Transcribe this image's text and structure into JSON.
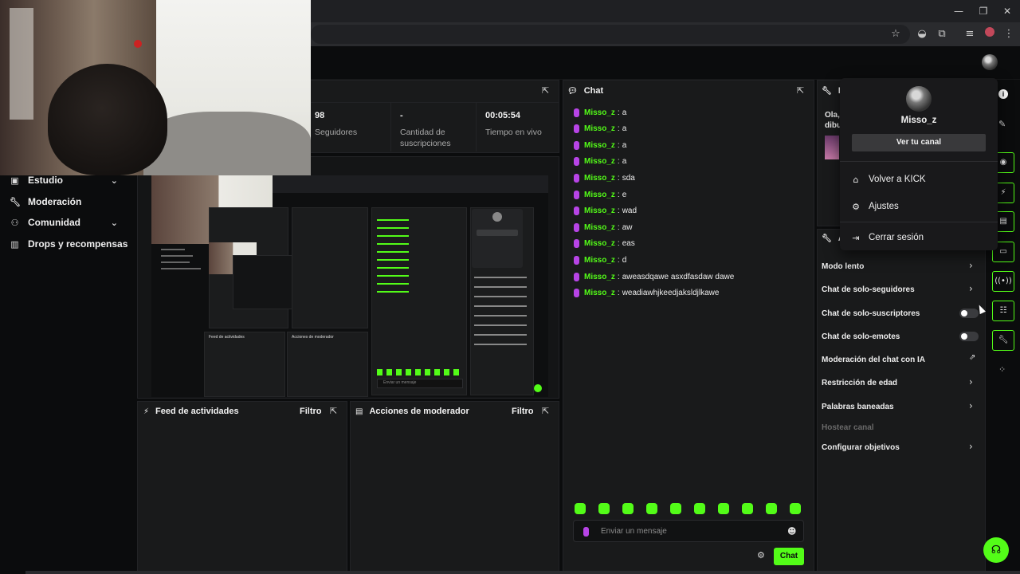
{
  "window": {
    "minimize": "—",
    "maximize": "❐",
    "close": "✕"
  },
  "toolbar_icons": [
    "star-icon",
    "cast-icon",
    "extensions-icon",
    "media-icon",
    "profile-icon",
    "menu-icon"
  ],
  "sidebar": {
    "items": [
      {
        "label": "Estudio",
        "icon": "studio-icon",
        "has_chevron": true
      },
      {
        "label": "Moderación",
        "icon": "wrench-icon",
        "has_chevron": false
      },
      {
        "label": "Comunidad",
        "icon": "community-icon",
        "has_chevron": true
      },
      {
        "label": "Drops y recompensas",
        "icon": "rewards-icon",
        "has_chevron": false
      }
    ]
  },
  "stats": [
    {
      "value": "98",
      "label": "Seguidores"
    },
    {
      "value": "-",
      "label": "Cantidad de suscripciones"
    },
    {
      "value": "00:05:54",
      "label": "Tiempo en vivo"
    }
  ],
  "panels": {
    "activity_feed": {
      "title": "Feed de actividades",
      "filter": "Filtro"
    },
    "mod_actions": {
      "title": "Acciones de moderador",
      "filter": "Filtro"
    },
    "chat_title": "Chat",
    "info_partial": "In",
    "info_text_1": "Ola,",
    "info_text_2": "dibu",
    "mod_settings_partial": "Ac"
  },
  "chat": {
    "messages": [
      {
        "user": "Misso_z",
        "text": "a"
      },
      {
        "user": "Misso_z",
        "text": "a"
      },
      {
        "user": "Misso_z",
        "text": "a"
      },
      {
        "user": "Misso_z",
        "text": "a"
      },
      {
        "user": "Misso_z",
        "text": "sda"
      },
      {
        "user": "Misso_z",
        "text": "e"
      },
      {
        "user": "Misso_z",
        "text": "wad"
      },
      {
        "user": "Misso_z",
        "text": "aw"
      },
      {
        "user": "Misso_z",
        "text": "eas"
      },
      {
        "user": "Misso_z",
        "text": "d"
      },
      {
        "user": "Misso_z",
        "text": "aweasdqawe asxdfasdaw dawe"
      },
      {
        "user": "Misso_z",
        "text": "weadiawhjkeedjaksldjlkawe"
      }
    ],
    "placeholder": "Enviar un mensaje",
    "send_label": "Chat"
  },
  "mod_settings": [
    {
      "label": "Modo lento",
      "control": "arrow"
    },
    {
      "label": "Chat de solo-seguidores",
      "control": "arrow"
    },
    {
      "label": "Chat de solo-suscriptores",
      "control": "toggle",
      "on": false
    },
    {
      "label": "Chat de solo-emotes",
      "control": "toggle",
      "on": false
    },
    {
      "label": "Moderación del chat con IA",
      "control": "external"
    },
    {
      "label": "Restricción de edad",
      "control": "arrow"
    },
    {
      "label": "Palabras baneadas",
      "control": "arrow"
    },
    {
      "label": "Hostear canal",
      "control": "none",
      "disabled": true
    },
    {
      "label": "Configurar objetivos",
      "control": "arrow"
    }
  ],
  "user_menu": {
    "username": "Misso_z",
    "view_channel": "Ver tu canal",
    "items": [
      {
        "label": "Volver a KICK",
        "icon": "home-icon"
      },
      {
        "label": "Ajustes",
        "icon": "gear-icon"
      },
      {
        "label": "Cerrar sesión",
        "icon": "logout-icon"
      }
    ]
  },
  "preview": {
    "nested_chat_placeholder": "Enviar un mensaje",
    "nested_feed": "Feed de actividades",
    "nested_mod": "Acciones de moderador"
  },
  "colors": {
    "accent": "#53fc18",
    "mic": "#b744e6",
    "panel": "#191a1b",
    "bg": "#0b0c0d"
  }
}
